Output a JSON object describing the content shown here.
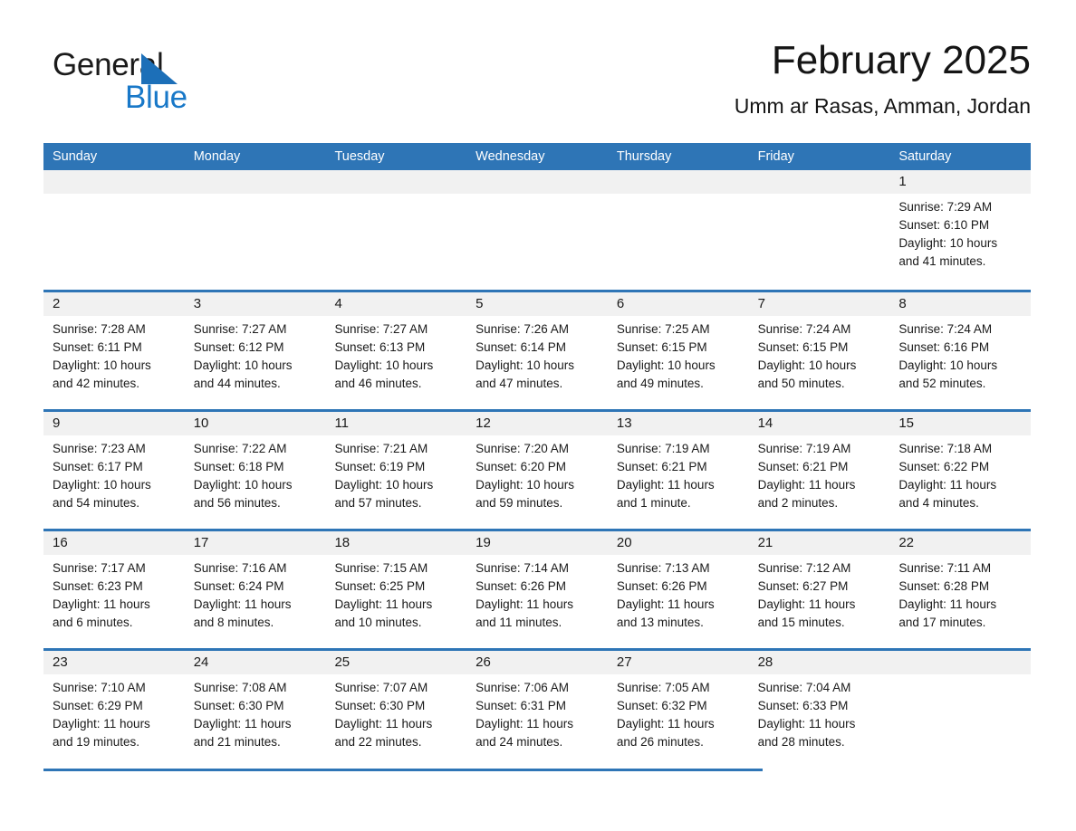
{
  "brand": {
    "name_part1": "General",
    "name_part2": "Blue",
    "logo_icon": "blue-triangle",
    "color_black": "#1b1b1b",
    "color_blue": "#1878c8"
  },
  "header": {
    "month_title": "February 2025",
    "location": "Umm ar Rasas, Amman, Jordan"
  },
  "theme": {
    "header_blue": "#2e75b6",
    "day_band_gray": "#f1f1f1",
    "text": "#1a1a1a"
  },
  "calendar": {
    "weekdays": [
      "Sunday",
      "Monday",
      "Tuesday",
      "Wednesday",
      "Thursday",
      "Friday",
      "Saturday"
    ],
    "weeks": [
      [
        {
          "day": "",
          "lines": []
        },
        {
          "day": "",
          "lines": []
        },
        {
          "day": "",
          "lines": []
        },
        {
          "day": "",
          "lines": []
        },
        {
          "day": "",
          "lines": []
        },
        {
          "day": "",
          "lines": []
        },
        {
          "day": "1",
          "lines": [
            "Sunrise: 7:29 AM",
            "Sunset: 6:10 PM",
            "Daylight: 10 hours",
            "and 41 minutes."
          ]
        }
      ],
      [
        {
          "day": "2",
          "lines": [
            "Sunrise: 7:28 AM",
            "Sunset: 6:11 PM",
            "Daylight: 10 hours",
            "and 42 minutes."
          ]
        },
        {
          "day": "3",
          "lines": [
            "Sunrise: 7:27 AM",
            "Sunset: 6:12 PM",
            "Daylight: 10 hours",
            "and 44 minutes."
          ]
        },
        {
          "day": "4",
          "lines": [
            "Sunrise: 7:27 AM",
            "Sunset: 6:13 PM",
            "Daylight: 10 hours",
            "and 46 minutes."
          ]
        },
        {
          "day": "5",
          "lines": [
            "Sunrise: 7:26 AM",
            "Sunset: 6:14 PM",
            "Daylight: 10 hours",
            "and 47 minutes."
          ]
        },
        {
          "day": "6",
          "lines": [
            "Sunrise: 7:25 AM",
            "Sunset: 6:15 PM",
            "Daylight: 10 hours",
            "and 49 minutes."
          ]
        },
        {
          "day": "7",
          "lines": [
            "Sunrise: 7:24 AM",
            "Sunset: 6:15 PM",
            "Daylight: 10 hours",
            "and 50 minutes."
          ]
        },
        {
          "day": "8",
          "lines": [
            "Sunrise: 7:24 AM",
            "Sunset: 6:16 PM",
            "Daylight: 10 hours",
            "and 52 minutes."
          ]
        }
      ],
      [
        {
          "day": "9",
          "lines": [
            "Sunrise: 7:23 AM",
            "Sunset: 6:17 PM",
            "Daylight: 10 hours",
            "and 54 minutes."
          ]
        },
        {
          "day": "10",
          "lines": [
            "Sunrise: 7:22 AM",
            "Sunset: 6:18 PM",
            "Daylight: 10 hours",
            "and 56 minutes."
          ]
        },
        {
          "day": "11",
          "lines": [
            "Sunrise: 7:21 AM",
            "Sunset: 6:19 PM",
            "Daylight: 10 hours",
            "and 57 minutes."
          ]
        },
        {
          "day": "12",
          "lines": [
            "Sunrise: 7:20 AM",
            "Sunset: 6:20 PM",
            "Daylight: 10 hours",
            "and 59 minutes."
          ]
        },
        {
          "day": "13",
          "lines": [
            "Sunrise: 7:19 AM",
            "Sunset: 6:21 PM",
            "Daylight: 11 hours",
            "and 1 minute."
          ]
        },
        {
          "day": "14",
          "lines": [
            "Sunrise: 7:19 AM",
            "Sunset: 6:21 PM",
            "Daylight: 11 hours",
            "and 2 minutes."
          ]
        },
        {
          "day": "15",
          "lines": [
            "Sunrise: 7:18 AM",
            "Sunset: 6:22 PM",
            "Daylight: 11 hours",
            "and 4 minutes."
          ]
        }
      ],
      [
        {
          "day": "16",
          "lines": [
            "Sunrise: 7:17 AM",
            "Sunset: 6:23 PM",
            "Daylight: 11 hours",
            "and 6 minutes."
          ]
        },
        {
          "day": "17",
          "lines": [
            "Sunrise: 7:16 AM",
            "Sunset: 6:24 PM",
            "Daylight: 11 hours",
            "and 8 minutes."
          ]
        },
        {
          "day": "18",
          "lines": [
            "Sunrise: 7:15 AM",
            "Sunset: 6:25 PM",
            "Daylight: 11 hours",
            "and 10 minutes."
          ]
        },
        {
          "day": "19",
          "lines": [
            "Sunrise: 7:14 AM",
            "Sunset: 6:26 PM",
            "Daylight: 11 hours",
            "and 11 minutes."
          ]
        },
        {
          "day": "20",
          "lines": [
            "Sunrise: 7:13 AM",
            "Sunset: 6:26 PM",
            "Daylight: 11 hours",
            "and 13 minutes."
          ]
        },
        {
          "day": "21",
          "lines": [
            "Sunrise: 7:12 AM",
            "Sunset: 6:27 PM",
            "Daylight: 11 hours",
            "and 15 minutes."
          ]
        },
        {
          "day": "22",
          "lines": [
            "Sunrise: 7:11 AM",
            "Sunset: 6:28 PM",
            "Daylight: 11 hours",
            "and 17 minutes."
          ]
        }
      ],
      [
        {
          "day": "23",
          "lines": [
            "Sunrise: 7:10 AM",
            "Sunset: 6:29 PM",
            "Daylight: 11 hours",
            "and 19 minutes."
          ]
        },
        {
          "day": "24",
          "lines": [
            "Sunrise: 7:08 AM",
            "Sunset: 6:30 PM",
            "Daylight: 11 hours",
            "and 21 minutes."
          ]
        },
        {
          "day": "25",
          "lines": [
            "Sunrise: 7:07 AM",
            "Sunset: 6:30 PM",
            "Daylight: 11 hours",
            "and 22 minutes."
          ]
        },
        {
          "day": "26",
          "lines": [
            "Sunrise: 7:06 AM",
            "Sunset: 6:31 PM",
            "Daylight: 11 hours",
            "and 24 minutes."
          ]
        },
        {
          "day": "27",
          "lines": [
            "Sunrise: 7:05 AM",
            "Sunset: 6:32 PM",
            "Daylight: 11 hours",
            "and 26 minutes."
          ]
        },
        {
          "day": "28",
          "lines": [
            "Sunrise: 7:04 AM",
            "Sunset: 6:33 PM",
            "Daylight: 11 hours",
            "and 28 minutes."
          ]
        },
        {
          "day": "",
          "lines": []
        }
      ]
    ]
  }
}
